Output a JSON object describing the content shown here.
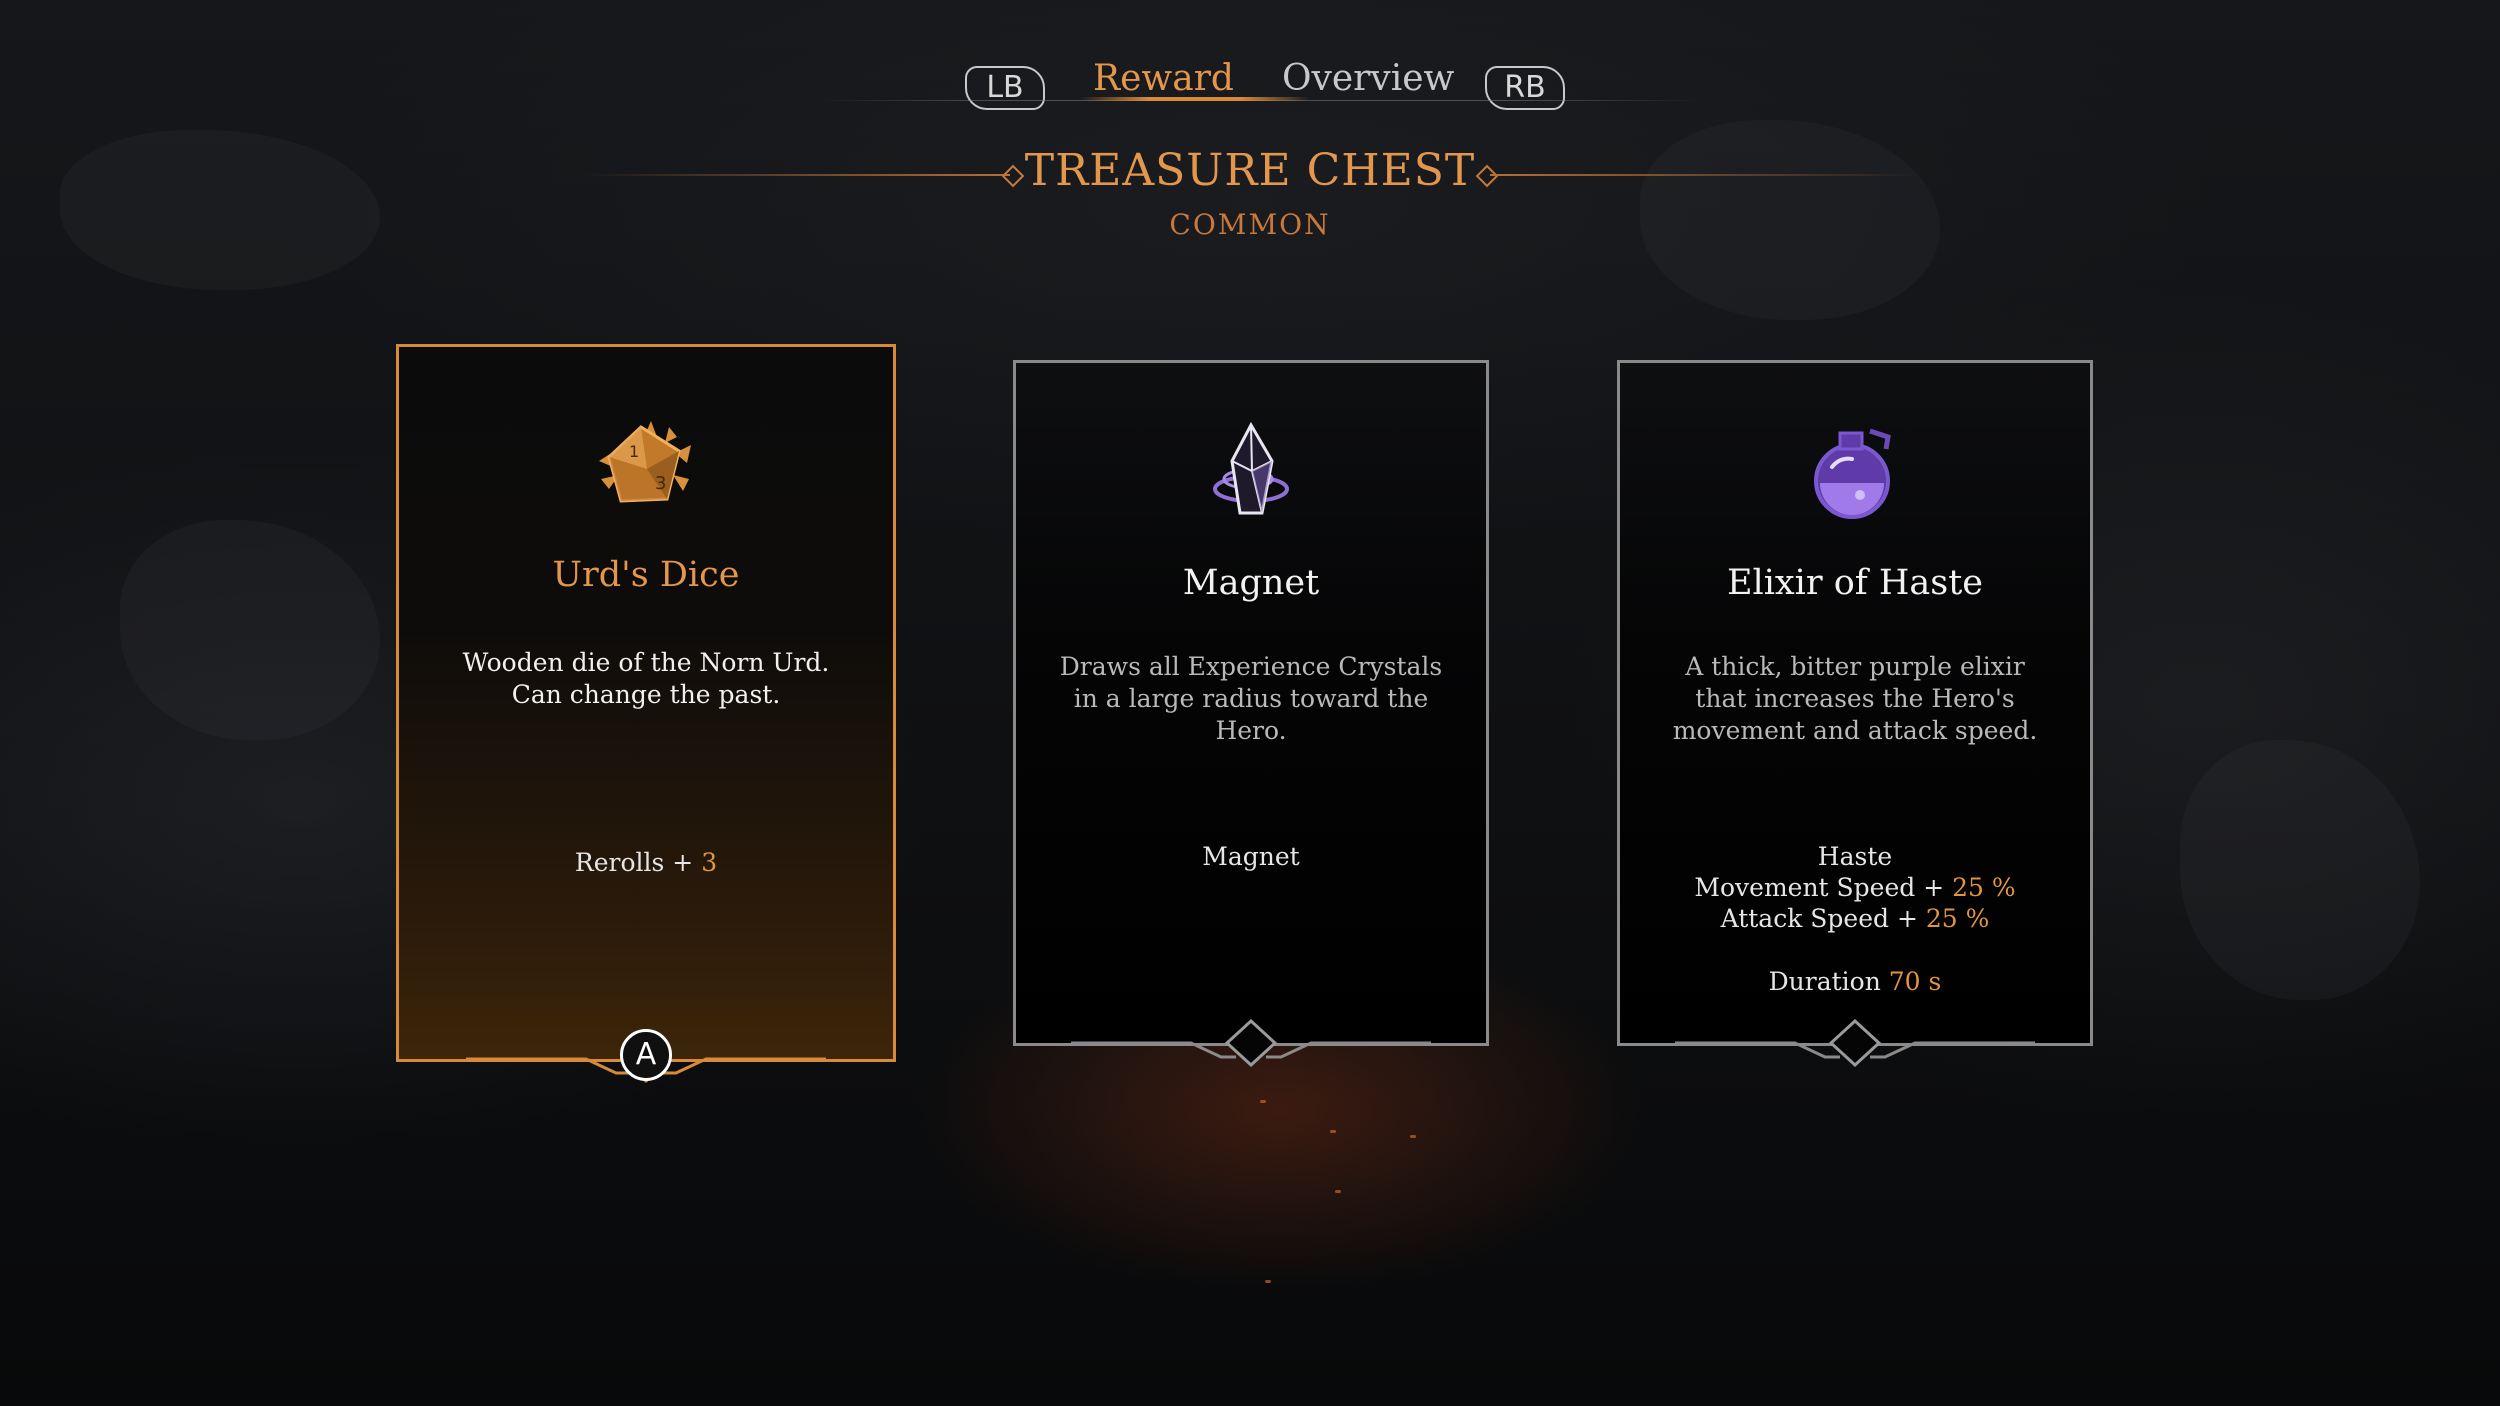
{
  "nav": {
    "lb_label": "LB",
    "rb_label": "RB",
    "tabs": [
      {
        "label": "Reward",
        "active": true
      },
      {
        "label": "Overview",
        "active": false
      }
    ]
  },
  "header": {
    "title": "TREASURE CHEST",
    "rarity": "COMMON"
  },
  "colors": {
    "accent": "#e4974b",
    "selected_border": "#d68a3a",
    "card_border": "#8a8a8a"
  },
  "cards": [
    {
      "name": "Urd's Dice",
      "icon": "dice-icon",
      "selected": true,
      "description": "Wooden die of the Norn Urd. Can change the past.",
      "stats": [
        {
          "label": "Rerolls + ",
          "value": "3"
        }
      ],
      "confirm_button": "A"
    },
    {
      "name": "Magnet",
      "icon": "crystal-icon",
      "selected": false,
      "description": "Draws all Experience Crystals in a large radius toward the Hero.",
      "stats": [
        {
          "label": "Magnet",
          "value": ""
        }
      ]
    },
    {
      "name": "Elixir of Haste",
      "icon": "potion-icon",
      "selected": false,
      "description": "A thick, bitter purple elixir that increases the Hero's movement and attack speed.",
      "stats": [
        {
          "label": "Haste",
          "value": ""
        },
        {
          "label": "Movement Speed + ",
          "value": "25 %"
        },
        {
          "label": "Attack Speed + ",
          "value": "25 %"
        },
        {
          "label": "Duration ",
          "value": "70 s"
        }
      ]
    }
  ]
}
